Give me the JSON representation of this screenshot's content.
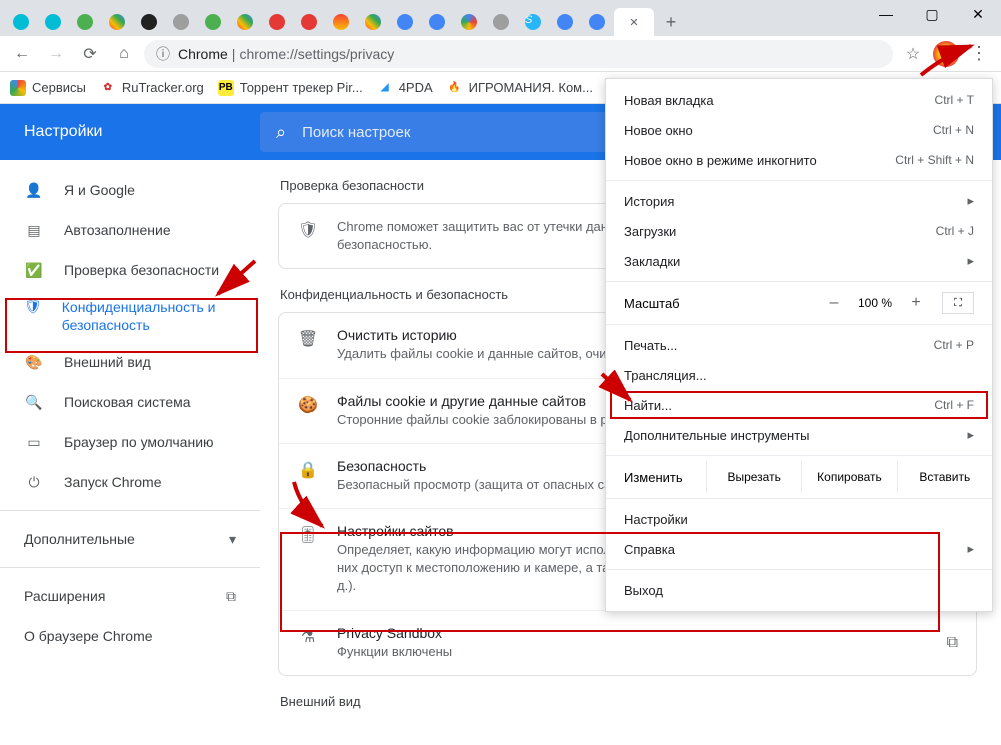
{
  "window": {
    "min": "—",
    "max": "▢",
    "close": "✕"
  },
  "tabs": {
    "close_active": "✕",
    "new": "+"
  },
  "toolbar": {
    "url_host": "Chrome",
    "url_sep": " | ",
    "url_path": "chrome://settings/privacy"
  },
  "bookmarks": {
    "apps": "Сервисы",
    "rutracker": "RuTracker.org",
    "torrent": "Торрент трекер Pir...",
    "pda": "4PDA",
    "igro": "ИГРОМАНИЯ. Ком..."
  },
  "settings_header": {
    "title": "Настройки",
    "search_ph": "Поиск настроек"
  },
  "sidebar": {
    "you": "Я и Google",
    "autofill": "Автозаполнение",
    "safety": "Проверка безопасности",
    "privacy": "Конфиденциальность и безопасность",
    "appearance": "Внешний вид",
    "search": "Поисковая система",
    "default_browser": "Браузер по умолчанию",
    "startup": "Запуск Chrome",
    "advanced": "Дополнительные",
    "extensions": "Расширения",
    "about": "О браузере Chrome"
  },
  "content": {
    "sec_safety": "Проверка безопасности",
    "safety_text": "Chrome поможет защитить вас от утечки данных, небезопасных расширений и других проблем с безопасностью.",
    "sec_privacy": "Конфиденциальность и безопасность",
    "clear_t": "Очистить историю",
    "clear_s": "Удалить файлы cookie и данные сайтов, очистить историю...",
    "cookies_t": "Файлы cookie и другие данные сайтов",
    "cookies_s": "Сторонние файлы cookie заблокированы в режиме инкогнито",
    "security_t": "Безопасность",
    "security_s": "Безопасный просмотр (защита от опасных сайтов) и другие настройки безопасности",
    "site_t": "Настройки сайтов",
    "site_s": "Определяет, какую информацию могут использовать и показывать сайты (например, есть ли у них доступ к местоположению и камере, а также разрешение на показ всплывающих окон и т. д.).",
    "sandbox_t": "Privacy Sandbox",
    "sandbox_s": "Функции включены",
    "sec_appearance": "Внешний вид"
  },
  "menu": {
    "new_tab": "Новая вкладка",
    "sc_new_tab": "Ctrl + T",
    "new_win": "Новое окно",
    "sc_new_win": "Ctrl + N",
    "incognito": "Новое окно в режиме инкогнито",
    "sc_incognito": "Ctrl + Shift + N",
    "history": "История",
    "downloads": "Загрузки",
    "sc_downloads": "Ctrl + J",
    "bookmarks": "Закладки",
    "zoom": "Масштаб",
    "zoom_val": "100 %",
    "print": "Печать...",
    "sc_print": "Ctrl + P",
    "cast": "Трансляция...",
    "find": "Найти...",
    "sc_find": "Ctrl + F",
    "tools": "Дополнительные инструменты",
    "edit": "Изменить",
    "cut": "Вырезать",
    "copy": "Копировать",
    "paste": "Вставить",
    "settings": "Настройки",
    "help": "Справка",
    "exit": "Выход"
  }
}
